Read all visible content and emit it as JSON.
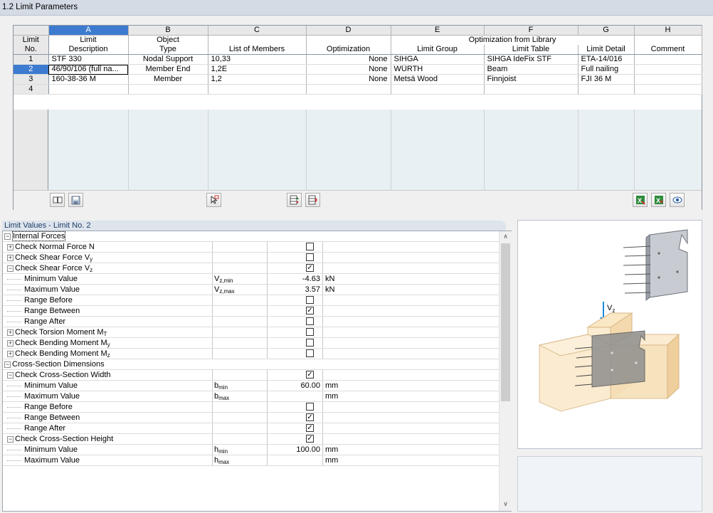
{
  "window": {
    "title": "1.2 Limit Parameters"
  },
  "grid": {
    "letters": [
      "A",
      "B",
      "C",
      "D",
      "E",
      "F",
      "G",
      "H"
    ],
    "header1": {
      "limit": "Limit",
      "a": "Limit",
      "b": "Object",
      "ef": "Optimization from Library"
    },
    "header2": {
      "no": "No.",
      "a": "Description",
      "b": "Type",
      "c": "List of Members",
      "d": "Optimization",
      "e": "Limit Group",
      "f": "Limit Table",
      "g": "Limit Detail",
      "h": "Comment"
    },
    "rows": [
      {
        "no": "1",
        "description": "STF 330",
        "type": "Nodal Support",
        "members": "10,33",
        "optimization": "None",
        "group": "SIHGA",
        "table": "SIHGA IdeFix STF",
        "detail": "ETA-14/016",
        "comment": ""
      },
      {
        "no": "2",
        "description": "46/90/106 (full na...",
        "type": "Member End",
        "members": "1,2E",
        "optimization": "None",
        "group": "WÜRTH",
        "table": "Beam",
        "detail": "Full nailing",
        "comment": ""
      },
      {
        "no": "3",
        "description": "160-38-36 M",
        "type": "Member",
        "members": "1,2",
        "optimization": "None",
        "group": "Metsä Wood",
        "table": "Finnjoist",
        "detail": "FJI 36 M",
        "comment": ""
      },
      {
        "no": "4",
        "description": "",
        "type": "",
        "members": "",
        "optimization": "",
        "group": "",
        "table": "",
        "detail": "",
        "comment": ""
      }
    ]
  },
  "limit_values": {
    "title": "Limit Values - Limit No. 2",
    "rows": [
      {
        "kind": "section",
        "label": "Internal Forces",
        "expander": "−"
      },
      {
        "kind": "check",
        "expander": "+",
        "label": "Check Normal Force N",
        "sym": "",
        "value": "",
        "unit": "",
        "checked": false
      },
      {
        "kind": "check",
        "expander": "+",
        "label": "Check Shear Force V",
        "sub": "y",
        "sym": "",
        "value": "",
        "unit": "",
        "checked": false
      },
      {
        "kind": "check",
        "expander": "−",
        "label": "Check Shear Force V",
        "sub": "z",
        "sym": "",
        "value": "",
        "unit": "",
        "checked": true
      },
      {
        "kind": "leaf",
        "label": "Minimum Value",
        "sym": "V",
        "symsub": "z,min",
        "value": "-4.63",
        "unit": "kN"
      },
      {
        "kind": "leaf",
        "label": "Maximum Value",
        "sym": "V",
        "symsub": "z,max",
        "value": "3.57",
        "unit": "kN"
      },
      {
        "kind": "leafchk",
        "label": "Range Before",
        "checked": false
      },
      {
        "kind": "leafchk",
        "label": "Range Between",
        "checked": true
      },
      {
        "kind": "leafchk",
        "label": "Range After",
        "checked": false
      },
      {
        "kind": "check",
        "expander": "+",
        "label": "Check Torsion Moment M",
        "sub": "T",
        "sym": "",
        "value": "",
        "unit": "",
        "checked": false
      },
      {
        "kind": "check",
        "expander": "+",
        "label": "Check Bending Moment M",
        "sub": "y",
        "sym": "",
        "value": "",
        "unit": "",
        "checked": false
      },
      {
        "kind": "check",
        "expander": "+",
        "label": "Check Bending Moment M",
        "sub": "z",
        "sym": "",
        "value": "",
        "unit": "",
        "checked": false
      },
      {
        "kind": "section",
        "label": "Cross-Section Dimensions",
        "expander": "−"
      },
      {
        "kind": "check",
        "expander": "−",
        "label": "Check Cross-Section Width",
        "sym": "",
        "value": "",
        "unit": "",
        "checked": true
      },
      {
        "kind": "leaf",
        "label": "Minimum Value",
        "sym": "b",
        "symsub": "min",
        "value": "60.00",
        "unit": "mm"
      },
      {
        "kind": "leaf",
        "label": "Maximum Value",
        "sym": "b",
        "symsub": "max",
        "value": "",
        "unit": "mm"
      },
      {
        "kind": "leafchk",
        "label": "Range Before",
        "checked": false
      },
      {
        "kind": "leafchk",
        "label": "Range Between",
        "checked": true
      },
      {
        "kind": "leafchk",
        "label": "Range After",
        "checked": true
      },
      {
        "kind": "check",
        "expander": "−",
        "label": "Check Cross-Section Height",
        "sym": "",
        "value": "",
        "unit": "",
        "checked": true
      },
      {
        "kind": "leaf",
        "label": "Minimum Value",
        "sym": "h",
        "symsub": "min",
        "value": "100.00",
        "unit": "mm"
      },
      {
        "kind": "leaf",
        "label": "Maximum Value",
        "sym": "h",
        "symsub": "max",
        "value": "",
        "unit": "mm"
      }
    ]
  },
  "figure": {
    "force_label": "V",
    "force_sub": "z"
  },
  "colors": {
    "selection": "#3d7bd0",
    "grid_empty": "#e9f0f3",
    "title_bar": "#d4dbe5"
  }
}
